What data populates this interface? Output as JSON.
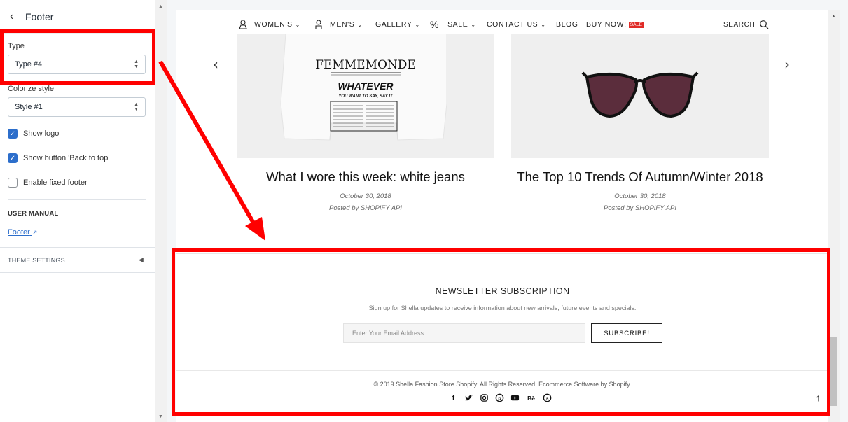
{
  "sidebar": {
    "title": "Footer",
    "back_icon": "chevron-left-icon",
    "type_label": "Type",
    "type_value": "Type #4",
    "colorize_label": "Colorize style",
    "colorize_value": "Style #1",
    "checkboxes": [
      {
        "label": "Show logo",
        "checked": true
      },
      {
        "label": "Show button 'Back to top'",
        "checked": true
      },
      {
        "label": "Enable fixed footer",
        "checked": false
      }
    ],
    "user_manual_title": "USER MANUAL",
    "user_manual_link": "Footer",
    "theme_settings": "THEME SETTINGS"
  },
  "nav": {
    "items": [
      {
        "label": "WOMEN'S",
        "has_dropdown": true,
        "icon": "woman-icon"
      },
      {
        "label": "MEN'S",
        "has_dropdown": true,
        "icon": "man-icon"
      },
      {
        "label": "GALLERY",
        "has_dropdown": true
      },
      {
        "label": "SALE",
        "has_dropdown": true,
        "icon": "percent-icon"
      },
      {
        "label": "CONTACT US",
        "has_dropdown": true
      },
      {
        "label": "BLOG",
        "has_dropdown": false
      },
      {
        "label": "BUY NOW!",
        "badge": "SALE"
      }
    ],
    "search_label": "SEARCH"
  },
  "posts": [
    {
      "title": "What I wore this week: white jeans",
      "date": "October 30, 2018",
      "author": "Posted by SHOPIFY API",
      "image": "tshirt-femmemonde"
    },
    {
      "title": "The Top 10 Trends Of Autumn/Winter 2018",
      "date": "October 30, 2018",
      "author": "Posted by SHOPIFY API",
      "image": "cat-eye-sunglasses"
    }
  ],
  "shirt_text": {
    "brand": "FEMMEMONDE",
    "headline": "WHATEVER",
    "tagline": "YOU WANT TO SAY, SAY IT"
  },
  "footer": {
    "newsletter_title": "NEWSLETTER SUBSCRIPTION",
    "newsletter_desc": "Sign up for Shella updates to receive information about new arrivals, future events and specials.",
    "email_placeholder": "Enter Your Email Address",
    "subscribe_label": "SUBSCRIBE!",
    "copyright": "© 2019 Shella Fashion Store Shopify. All Rights Reserved. Ecommerce Software by Shopify.",
    "socials": [
      "facebook-icon",
      "twitter-icon",
      "instagram-icon",
      "pinterest-icon",
      "youtube-icon",
      "behance-icon",
      "skype-icon"
    ]
  },
  "colors": {
    "annotation": "#ff0000",
    "accent": "#2c6ecb",
    "badge": "#e02b27"
  }
}
